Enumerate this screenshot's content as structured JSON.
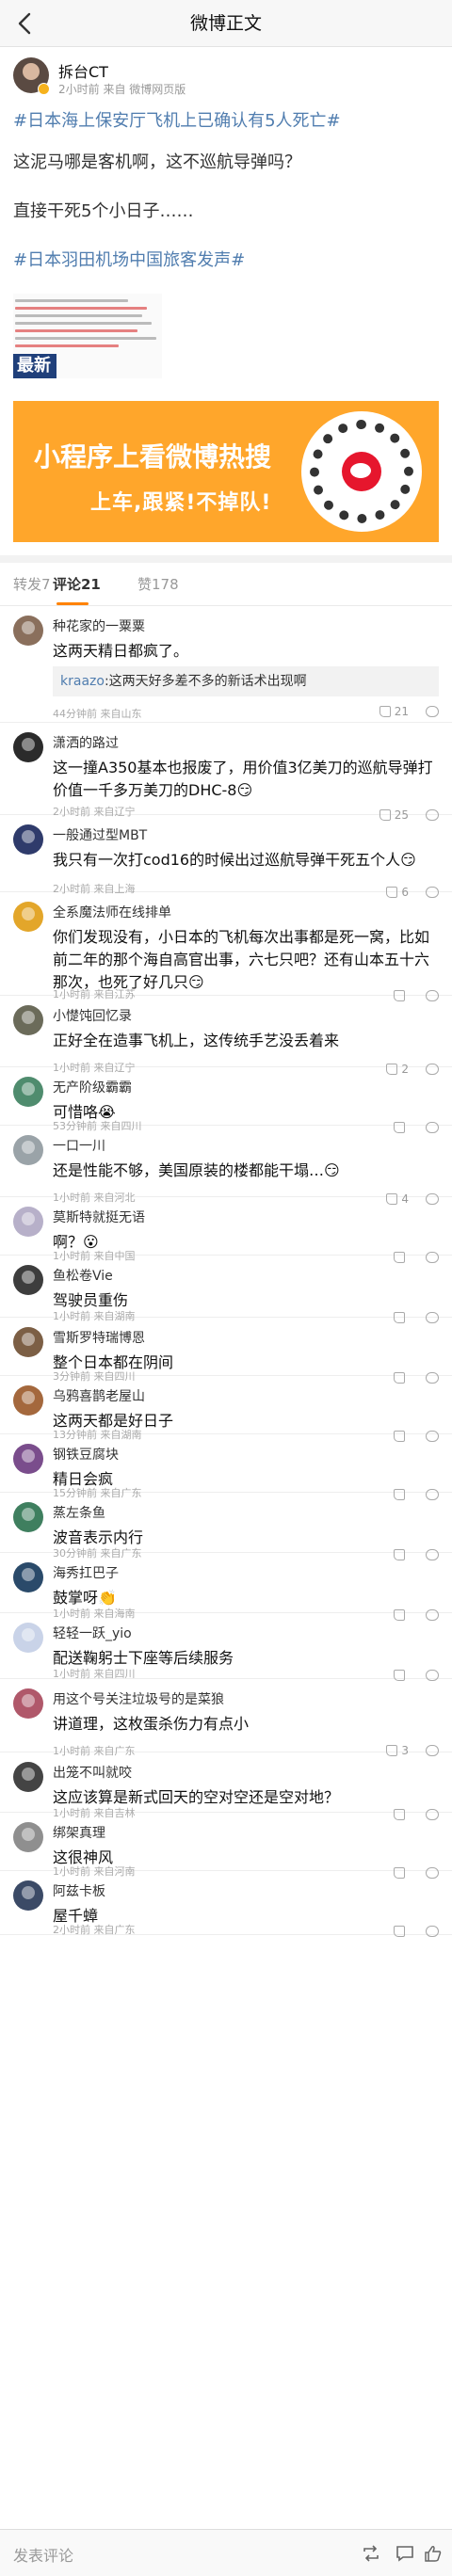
{
  "nav": {
    "title": "微博正文"
  },
  "post": {
    "username": "拆台CT",
    "meta": "2小时前 来自 微博网页版",
    "topic1": "#日本海上保安厅飞机上已确认有5人死亡#",
    "line1": "这泥马哪是客机啊，这不巡航导弹吗？",
    "line2": "直接干死5个小日子……",
    "topic2": "#日本羽田机场中国旅客发声#",
    "image_tag": "最新"
  },
  "banner": {
    "line1": "小程序上看微博热搜",
    "line2": "上车,跟紧!不掉队!"
  },
  "tabs": [
    {
      "label": "转发7"
    },
    {
      "label": "评论21"
    },
    {
      "label": "赞178"
    }
  ],
  "comments": [
    {
      "user": "种花家的一粟粟",
      "text": "这两天精日都疯了。",
      "reply_name": "kraazo",
      "reply_text": ":这两天好多差不多的新话术出现啊",
      "meta": "44分钟前 来自山东",
      "likes": "21",
      "avatar_color": "#8a6f5c"
    },
    {
      "user": "潇洒的路过",
      "text": "这一撞A350基本也报废了，用价值3亿美刀的巡航导弹打价值一千多万美刀的DHC-8😏",
      "meta": "2小时前 来自辽宁",
      "likes": "25",
      "avatar_color": "#2b2b2b"
    },
    {
      "user": "一般通过型MBT",
      "text": "我只有一次打cod16的时候出过巡航导弹干死五个人😏",
      "meta": "2小时前 来自上海",
      "likes": "6",
      "avatar_color": "#2f3b6b"
    },
    {
      "user": "全系魔法师在线排单",
      "text": "你们发现没有，小日本的飞机每次出事都是死一窝，比如前二年的那个海自高官出事，六七只吧？还有山本五十六那次，也死了好几只😏",
      "meta": "1小时前 来自江苏",
      "likes": "",
      "avatar_color": "#e3a62a"
    },
    {
      "user": "小憷饨回忆录",
      "text": "正好全在造事飞机上，这传统手艺没丢着来",
      "meta": "1小时前 来自辽宁",
      "likes": "2",
      "avatar_color": "#6b6b5a"
    },
    {
      "user": "无产阶级霸霸",
      "text": "可惜咯😭",
      "meta": "53分钟前 来自四川",
      "likes": "",
      "avatar_color": "#4f8c6e"
    },
    {
      "user": "一口一川",
      "text": "还是性能不够，美国原装的楼都能干塌…😏",
      "meta": "1小时前 来自河北",
      "likes": "4",
      "avatar_color": "#9aa3a8"
    },
    {
      "user": "莫斯特就挺无语",
      "text": "啊？😮",
      "meta": "1小时前 来自中国",
      "likes": "",
      "avatar_color": "#b7b0c9"
    },
    {
      "user": "鱼松卷Vie",
      "text": "驾驶员重伤",
      "meta": "1小时前 来自湖南",
      "likes": "",
      "avatar_color": "#3d3d3d"
    },
    {
      "user": "雪斯罗特瑞博恩",
      "text": "整个日本都在阴间",
      "meta": "3分钟前 来自四川",
      "likes": "",
      "avatar_color": "#7c5f45"
    },
    {
      "user": "乌鸦喜鹊老屋山",
      "text": "这两天都是好日子",
      "meta": "13分钟前 来自湖南",
      "likes": "",
      "avatar_color": "#a4683d"
    },
    {
      "user": "钢铁豆腐块",
      "text": "精日会疯",
      "meta": "15分钟前 来自广东",
      "likes": "",
      "avatar_color": "#7a4d8c"
    },
    {
      "user": "蒸左条鱼",
      "text": "波音表示内行",
      "meta": "30分钟前 来自广东",
      "likes": "",
      "avatar_color": "#3f7f5f"
    },
    {
      "user": "海秀扛巴子",
      "text": "鼓掌呀👏",
      "meta": "1小时前 来自海南",
      "likes": "",
      "avatar_color": "#2a4a6a"
    },
    {
      "user": "轻轻一跃_yio",
      "text": "配送鞠躬士下座等后续服务",
      "meta": "1小时前 来自四川",
      "likes": "",
      "avatar_color": "#c9d3e8"
    },
    {
      "user": "用这个号关注垃圾号的是菜狼",
      "text": "讲道理，这枚蛋杀伤力有点小",
      "meta": "1小时前 来自广东",
      "likes": "3",
      "avatar_color": "#b0586a"
    },
    {
      "user": "出笼不叫就咬",
      "text": "这应该算是新式回天的空对空还是空对地？",
      "meta": "1小时前 来自吉林",
      "likes": "",
      "avatar_color": "#444444"
    },
    {
      "user": "绑架真理",
      "text": "这很神风",
      "meta": "1小时前 来自河南",
      "likes": "",
      "avatar_color": "#8f8f8f"
    },
    {
      "user": "阿兹卡板",
      "text": "屋千蟑",
      "meta": "2小时前 来自广东",
      "likes": "",
      "avatar_color": "#3b4a66"
    }
  ],
  "bottom": {
    "placeholder": "发表评论"
  },
  "colors": {
    "accent": "#ff8200",
    "link": "#507daf",
    "banner": "#ffa62b"
  }
}
